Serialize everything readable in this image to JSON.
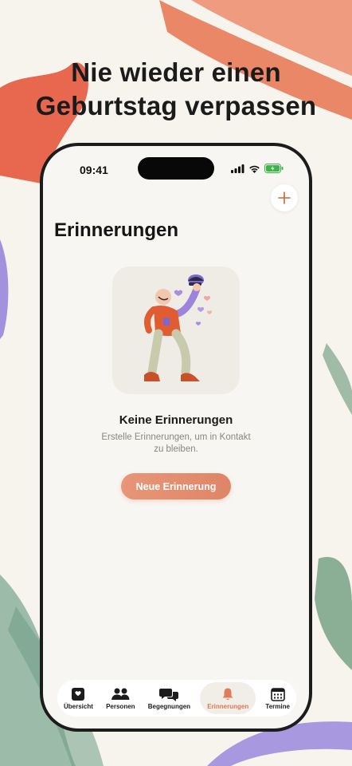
{
  "headline": {
    "line1": "Nie wieder einen",
    "line2": "Geburtstag verpassen"
  },
  "status_bar": {
    "time": "09:41",
    "icons": [
      "signal-icon",
      "wifi-icon",
      "battery-icon"
    ]
  },
  "header": {
    "add_icon": "plus-icon"
  },
  "page": {
    "title": "Erinnerungen"
  },
  "empty_state": {
    "title": "Keine Erinnerungen",
    "subtitle_line1": "Erstelle Erinnerungen, um in Kontakt",
    "subtitle_line2": "zu bleiben.",
    "button_label": "Neue Erinnerung"
  },
  "tabbar": {
    "items": [
      {
        "label": "Übersicht",
        "icon": "heart-square-icon",
        "active": false
      },
      {
        "label": "Personen",
        "icon": "people-icon",
        "active": false
      },
      {
        "label": "Begegnungen",
        "icon": "chat-bubbles-icon",
        "active": false
      },
      {
        "label": "Erinnerungen",
        "icon": "bell-icon",
        "active": true
      },
      {
        "label": "Termine",
        "icon": "calendar-icon",
        "active": false
      }
    ]
  },
  "colors": {
    "accent": "#df8567",
    "background": "#f7f4ee",
    "phone_frame": "#1c1c1c"
  }
}
